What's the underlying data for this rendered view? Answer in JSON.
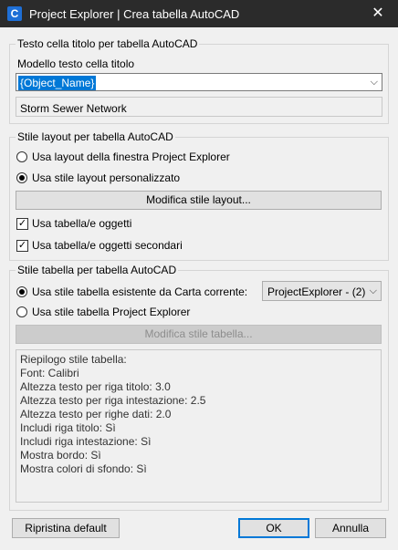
{
  "window": {
    "title": "Project Explorer | Crea tabella AutoCAD",
    "icon_letter": "C",
    "close_glyph": "✕"
  },
  "header_group": {
    "title": "Testo cella titolo per tabella AutoCAD",
    "template_label": "Modello testo cella titolo",
    "template_value": "{Object_Name}",
    "preview_value": "Storm Sewer Network"
  },
  "layout_group": {
    "title": "Stile layout per tabella AutoCAD",
    "radio_window": "Usa layout della finestra Project Explorer",
    "radio_custom": "Usa stile layout personalizzato",
    "modify_button": "Modifica stile layout...",
    "check_objects": "Usa tabella/e oggetti",
    "check_secondary": "Usa tabella/e oggetti secondari"
  },
  "table_group": {
    "title": "Stile tabella per tabella AutoCAD",
    "radio_existing": "Usa stile tabella esistente da Carta corrente:",
    "existing_value": "ProjectExplorer - (2)",
    "radio_project": "Usa stile tabella Project Explorer",
    "modify_button": "Modifica stile tabella...",
    "summary_lines": [
      "Riepilogo stile tabella:",
      "Font: Calibri",
      "Altezza testo per riga titolo: 3.0",
      "Altezza testo per riga intestazione: 2.5",
      "Altezza testo per righe dati: 2.0",
      "Includi riga titolo: Sì",
      "Includi riga intestazione: Sì",
      "Mostra bordo: Sì",
      "Mostra colori di sfondo: Sì"
    ]
  },
  "footer": {
    "reset": "Ripristina default",
    "ok": "OK",
    "cancel": "Annulla"
  }
}
